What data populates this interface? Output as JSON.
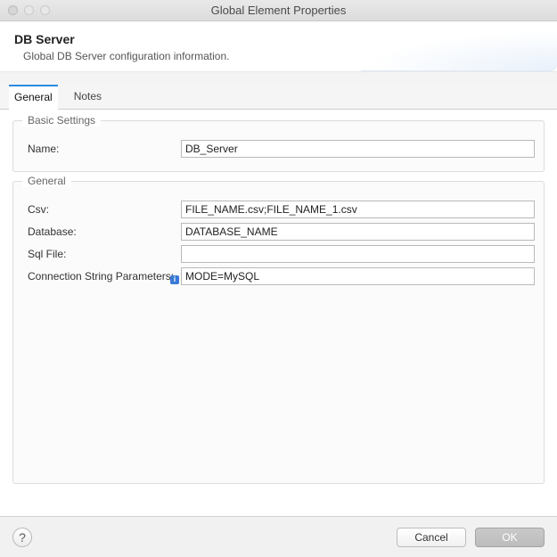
{
  "window": {
    "title": "Global Element Properties"
  },
  "header": {
    "title": "DB Server",
    "subtitle": "Global DB Server configuration information."
  },
  "tabs": [
    {
      "label": "General",
      "active": true
    },
    {
      "label": "Notes",
      "active": false
    }
  ],
  "groups": {
    "basic": {
      "title": "Basic Settings",
      "fields": {
        "name": {
          "label": "Name:",
          "value": "DB_Server"
        }
      }
    },
    "general": {
      "title": "General",
      "fields": {
        "csv": {
          "label": "Csv:",
          "value": "FILE_NAME.csv;FILE_NAME_1.csv"
        },
        "database": {
          "label": "Database:",
          "value": "DATABASE_NAME"
        },
        "sqlfile": {
          "label": "Sql File:",
          "value": ""
        },
        "connparams": {
          "label": "Connection String Parameters:",
          "value": "MODE=MySQL"
        }
      }
    }
  },
  "buttons": {
    "help": "?",
    "cancel": "Cancel",
    "ok": "OK"
  }
}
